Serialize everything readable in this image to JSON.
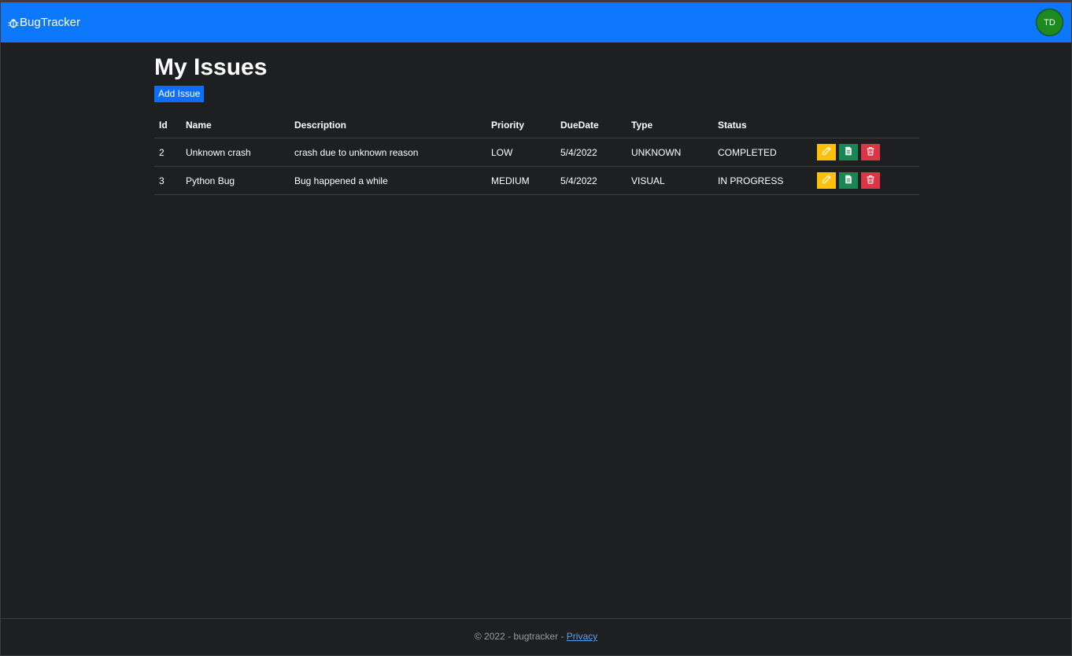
{
  "navbar": {
    "brand": "BugTracker",
    "avatar_initials": "TD",
    "colors": {
      "navbar": "#0d78fb",
      "avatar": "#1c8a1f"
    }
  },
  "page": {
    "title": "My Issues",
    "add_button": "Add Issue"
  },
  "table": {
    "headers": [
      "Id",
      "Name",
      "Description",
      "Priority",
      "DueDate",
      "Type",
      "Status"
    ],
    "rows": [
      {
        "id": "2",
        "name": "Unknown crash",
        "description": "crash due to unknown reason",
        "priority": "LOW",
        "due_date": "5/4/2022",
        "type": "UNKNOWN",
        "status": "COMPLETED"
      },
      {
        "id": "3",
        "name": "Python Bug",
        "description": "Bug happened a while",
        "priority": "MEDIUM",
        "due_date": "5/4/2022",
        "type": "VISUAL",
        "status": "IN PROGRESS"
      }
    ],
    "action_icons": [
      "pencil-icon",
      "document-icon",
      "trash-icon"
    ],
    "action_colors": {
      "edit": "#ffc107",
      "details": "#198754",
      "delete": "#dc3545"
    }
  },
  "footer": {
    "copyright": "© 2022 - bugtracker - ",
    "privacy_link": "Privacy"
  }
}
